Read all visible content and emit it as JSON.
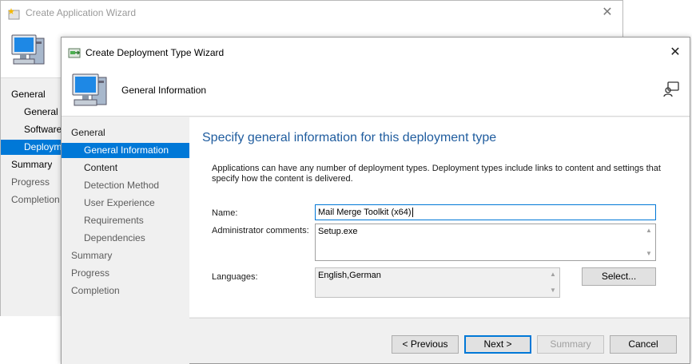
{
  "back_window": {
    "title": "Create Application Wizard",
    "nav": [
      "General",
      "General I",
      "Software",
      "Deployme",
      "Summary",
      "Progress",
      "Completion"
    ]
  },
  "front_window": {
    "title": "Create Deployment Type Wizard",
    "header_title": "General Information",
    "nav": {
      "general": "General",
      "general_information": "General Information",
      "content": "Content",
      "detection_method": "Detection Method",
      "user_experience": "User Experience",
      "requirements": "Requirements",
      "dependencies": "Dependencies",
      "summary": "Summary",
      "progress": "Progress",
      "completion": "Completion"
    },
    "page_heading": "Specify general information for this deployment type",
    "description": "Applications can have any number of deployment types. Deployment types include links to content and settings that specify how the content is delivered.",
    "form": {
      "name_label": "Name:",
      "name_value": "Mail Merge Toolkit (x64)",
      "admin_comments_label": "Administrator comments:",
      "admin_comments_value": "Setup.exe",
      "languages_label": "Languages:",
      "languages_value": "English,German",
      "select_button": "Select..."
    },
    "buttons": {
      "previous": "< Previous",
      "next": "Next >",
      "summary": "Summary",
      "cancel": "Cancel"
    }
  },
  "colors": {
    "selection": "#0078d7",
    "heading": "#1f5c9e",
    "panel_bg": "#f0f0f0"
  },
  "icons": [
    "wizard-icon",
    "computer-icon",
    "close-icon",
    "help-icon",
    "scroll-up-icon",
    "scroll-down-icon"
  ]
}
